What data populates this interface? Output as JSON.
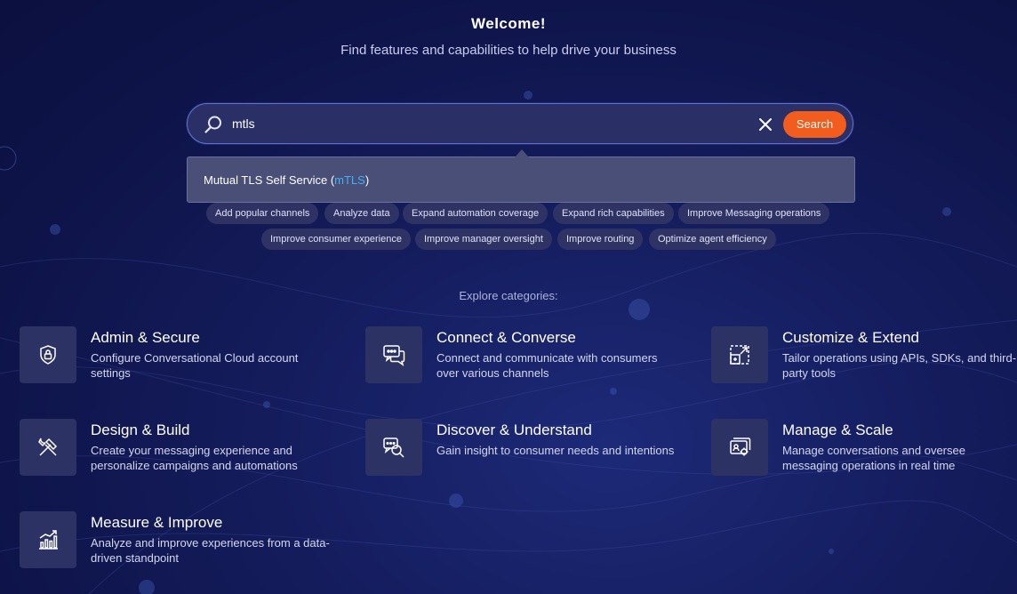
{
  "header": {
    "title": "Welcome!",
    "subtitle": "Find features and capabilities to help drive your business"
  },
  "search": {
    "query": "mtls",
    "button_label": "Search",
    "icons": {
      "search": "magnifier-icon",
      "clear": "close-icon"
    }
  },
  "suggestion": {
    "prefix": "Mutual TLS Self Service (",
    "highlight": "mTLS",
    "suffix": ")"
  },
  "chips": [
    "Add popular channels",
    "Analyze data",
    "Expand automation coverage",
    "Expand rich capabilities",
    "Improve Messaging operations",
    "Improve consumer experience",
    "Improve manager oversight",
    "Improve routing",
    "Optimize agent efficiency"
  ],
  "explore_label": "Explore categories:",
  "categories": [
    {
      "name": "Admin & Secure",
      "desc": "Configure Conversational Cloud account settings",
      "icon": "shield-lock-icon"
    },
    {
      "name": "Connect & Converse",
      "desc": "Connect and communicate with consumers over various channels",
      "icon": "chat-bubbles-icon"
    },
    {
      "name": "Customize & Extend",
      "desc": "Tailor operations using APIs, SDKs, and third-party tools",
      "icon": "expand-window-icon"
    },
    {
      "name": "Design & Build",
      "desc": "Create your messaging experience and personalize campaigns and automations",
      "icon": "tools-icon"
    },
    {
      "name": "Discover & Understand",
      "desc": "Gain insight to consumer needs and intentions",
      "icon": "chat-search-icon"
    },
    {
      "name": "Manage & Scale",
      "desc": "Manage conversations and oversee messaging operations in real time",
      "icon": "monitor-gear-icon"
    },
    {
      "name": "Measure & Improve",
      "desc": "Analyze and improve experiences from a data-driven standpoint",
      "icon": "growth-chart-icon"
    }
  ],
  "colors": {
    "accent": "#f25c1c",
    "highlight": "#3fb2f5",
    "background": "#141c5c"
  }
}
